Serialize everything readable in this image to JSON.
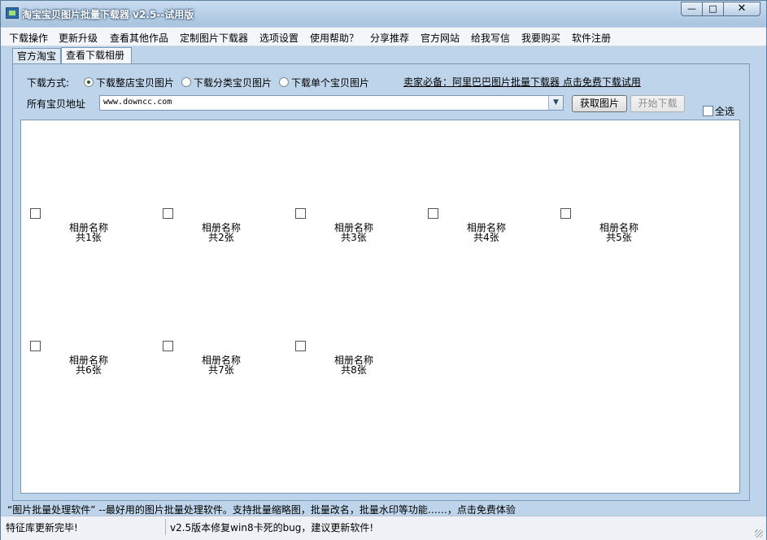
{
  "window": {
    "title": "淘宝宝贝图片批量下载器 v2.5--试用版",
    "controls": {
      "minimize": "—",
      "maximize": "□",
      "close": "✕"
    }
  },
  "menu": {
    "items": [
      "下载操作",
      "更新升级",
      "查看其他作品",
      "定制图片下载器",
      "选项设置",
      "使用帮助？",
      "分享推荐",
      "官方网站",
      "给我写信",
      "我要购买",
      "软件注册"
    ]
  },
  "tabs": [
    {
      "label": "官方淘宝",
      "active": false
    },
    {
      "label": "查看下载相册",
      "active": true
    }
  ],
  "download": {
    "mode_label": "下载方式:",
    "modes": [
      {
        "label": "下载整店宝贝图片",
        "selected": true
      },
      {
        "label": "下载分类宝贝图片",
        "selected": false
      },
      {
        "label": "下载单个宝贝图片",
        "selected": false
      }
    ],
    "promo_link": "卖家必备：阿里巴巴图片批量下载器 点击免费下载试用",
    "address_label": "所有宝贝地址",
    "address_value": "www.downcc.com",
    "fetch_button": "获取图片",
    "start_button": "开始下载",
    "select_all": "全选"
  },
  "albums": [
    {
      "name": "相册名称",
      "count": "共1张"
    },
    {
      "name": "相册名称",
      "count": "共2张"
    },
    {
      "name": "相册名称",
      "count": "共3张"
    },
    {
      "name": "相册名称",
      "count": "共4张"
    },
    {
      "name": "相册名称",
      "count": "共5张"
    },
    {
      "name": "相册名称",
      "count": "共6张"
    },
    {
      "name": "相册名称",
      "count": "共7张"
    },
    {
      "name": "相册名称",
      "count": "共8张"
    }
  ],
  "promo_text": "“图片批量处理软件” --最好用的图片批量处理软件。支持批量缩略图，批量改名，批量水印等功能……，点击免费体验",
  "status": {
    "left": "特征库更新完毕!",
    "right": "v2.5版本修复win8卡死的bug，建议更新软件!"
  }
}
